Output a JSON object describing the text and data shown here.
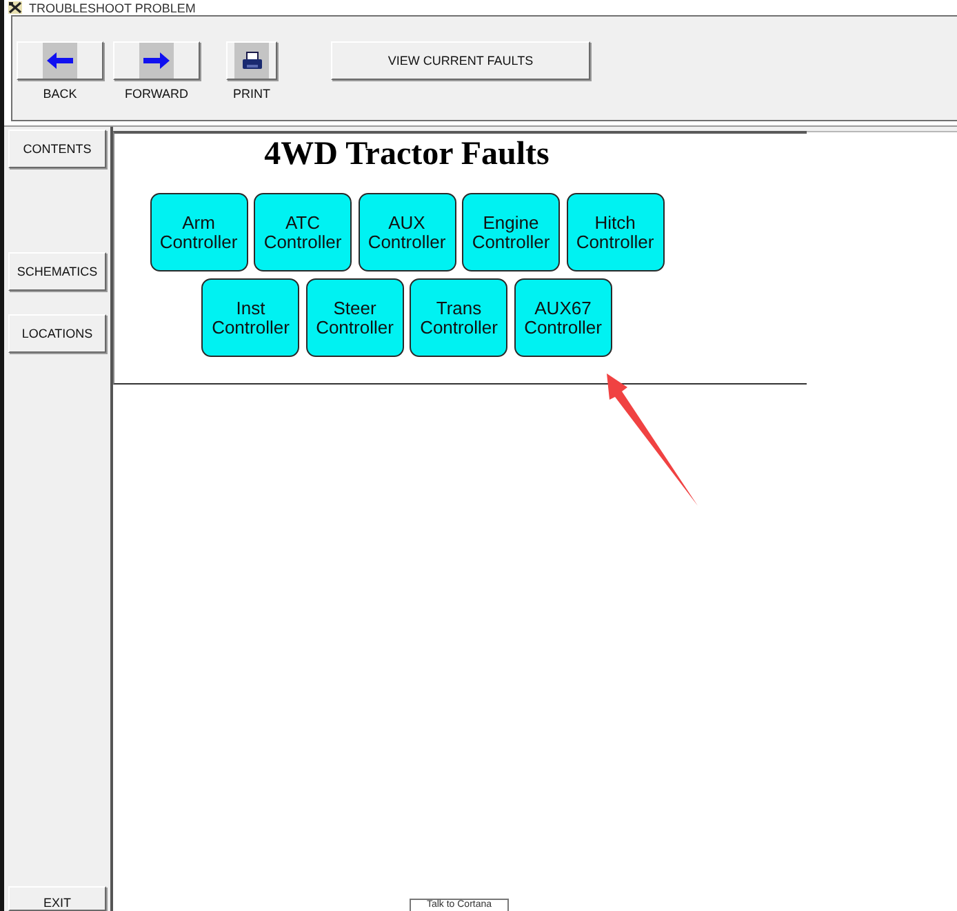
{
  "window": {
    "title": "TROUBLESHOOT PROBLEM"
  },
  "toolbar": {
    "buttons": [
      {
        "label": "BACK",
        "kind": "back"
      },
      {
        "label": "FORWARD",
        "kind": "forward"
      },
      {
        "label": "PRINT",
        "kind": "print"
      }
    ],
    "view_faults_button": "VIEW CURRENT FAULTS"
  },
  "sidebar": {
    "items": [
      "CONTENTS",
      "SCHEMATICS",
      "LOCATIONS"
    ],
    "exit_button": "EXIT"
  },
  "page": {
    "title": "4WD Tractor Faults",
    "controller_rows": [
      [
        "Arm Controller",
        "ATC Controller",
        "AUX Controller",
        "Engine Controller",
        "Hitch Controller"
      ],
      [
        "Inst Controller",
        "Steer Controller",
        "Trans Controller",
        "AUX67 Controller"
      ]
    ]
  },
  "taskbar_tooltip": "Talk to Cortana"
}
